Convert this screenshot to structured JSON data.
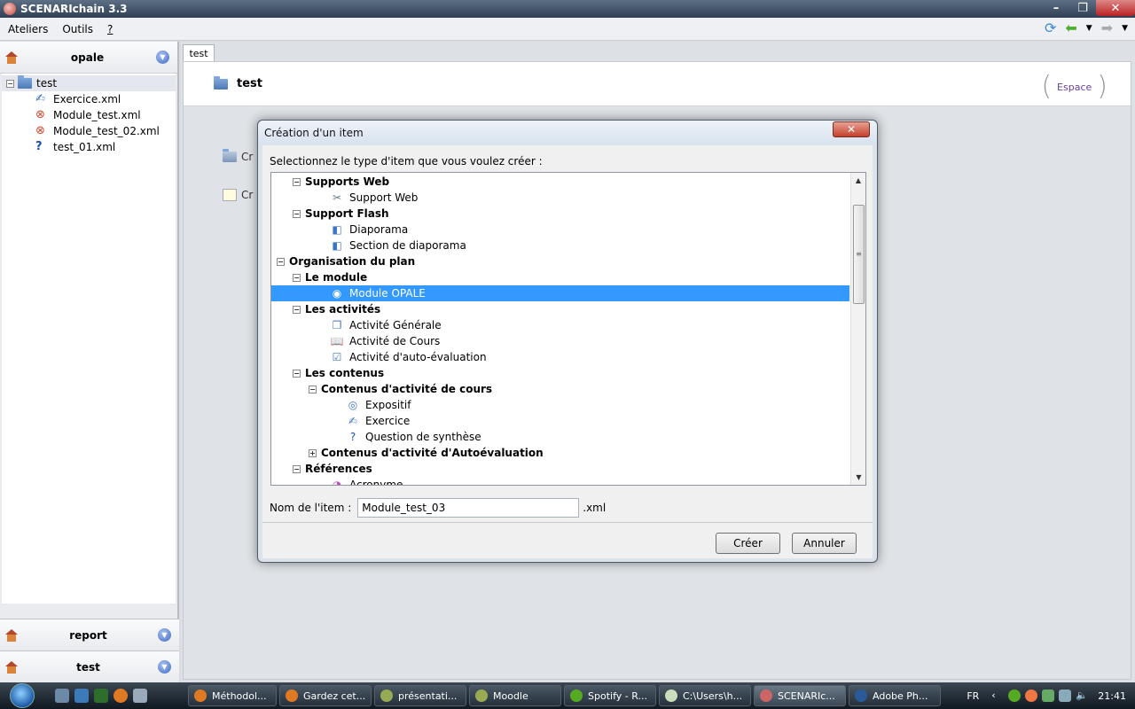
{
  "window": {
    "title": "SCENARIchain 3.3"
  },
  "menu": {
    "items": [
      "Ateliers",
      "Outils",
      "?"
    ]
  },
  "workspaces": {
    "top": "opale",
    "tree_root": "test",
    "files": [
      "Exercice.xml",
      "Module_test.xml",
      "Module_test_02.xml",
      "test_01.xml"
    ],
    "bottom": [
      "report",
      "test"
    ]
  },
  "main": {
    "tab": "test",
    "header_title": "test",
    "espace_label": "Espace",
    "create_links": [
      "Cr",
      "Cr"
    ]
  },
  "dialog": {
    "title": "Création d'un item",
    "prompt": "Selectionnez le type d'item que vous voulez créer :",
    "tree": [
      {
        "label": "Supports Web",
        "level": 1,
        "group": true,
        "expander": "minus"
      },
      {
        "label": "Support Web",
        "level": 2,
        "icon": "tools-icon"
      },
      {
        "label": "Support Flash",
        "level": 1,
        "group": true,
        "expander": "minus"
      },
      {
        "label": "Diaporama",
        "level": 2,
        "icon": "slide-icon"
      },
      {
        "label": "Section de diaporama",
        "level": 2,
        "icon": "slide-icon"
      },
      {
        "label": "Organisation du plan",
        "level": 0,
        "group": true,
        "expander": "minus"
      },
      {
        "label": "Le module",
        "level": 1,
        "group": true,
        "expander": "minus"
      },
      {
        "label": "Module OPALE",
        "level": 2,
        "icon": "module-icon",
        "selected": true
      },
      {
        "label": "Les activités",
        "level": 1,
        "group": true,
        "expander": "minus"
      },
      {
        "label": "Activité Générale",
        "level": 2,
        "icon": "activity-icon"
      },
      {
        "label": "Activité de Cours",
        "level": 2,
        "icon": "book-icon"
      },
      {
        "label": "Activité d'auto-évaluation",
        "level": 2,
        "icon": "checkbox-icon"
      },
      {
        "label": "Les contenus",
        "level": 1,
        "group": true,
        "expander": "minus"
      },
      {
        "label": "Contenus d'activité de cours",
        "level": 2,
        "group": true,
        "expander": "minus"
      },
      {
        "label": "Expositif",
        "level": 3,
        "icon": "eye-icon"
      },
      {
        "label": "Exercice",
        "level": 3,
        "icon": "exercise-icon"
      },
      {
        "label": "Question de synthèse",
        "level": 3,
        "icon": "question-icon"
      },
      {
        "label": "Contenus d'activité d'Autoévaluation",
        "level": 2,
        "group": true,
        "expander": "plus"
      },
      {
        "label": "Références",
        "level": 1,
        "group": true,
        "expander": "minus"
      },
      {
        "label": "Acronyme",
        "level": 2,
        "icon": "acronym-icon"
      }
    ],
    "name_label": "Nom de l'item :",
    "name_value": "Module_test_03",
    "name_ext": ".xml",
    "create_button": "Créer",
    "cancel_button": "Annuler"
  },
  "taskbar": {
    "tasks": [
      "Méthodol...",
      "Gardez cet...",
      "présentati...",
      "Moodle",
      "Spotify - R...",
      "C:\\Users\\h...",
      "SCENARIc...",
      "Adobe Ph..."
    ],
    "active_task": 6,
    "language": "FR",
    "clock": "21:41"
  }
}
